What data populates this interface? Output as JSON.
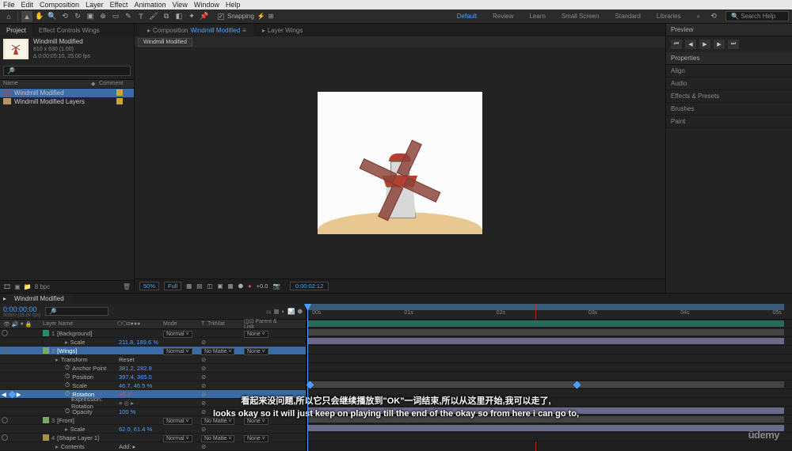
{
  "menu": {
    "items": [
      "File",
      "Edit",
      "Composition",
      "Layer",
      "Effect",
      "Animation",
      "View",
      "Window",
      "Help"
    ]
  },
  "toolbar": {
    "snapping": "Snapping"
  },
  "workspaces": {
    "items": [
      "Default",
      "Review",
      "Learn",
      "Small Screen",
      "Standard",
      "Libraries"
    ],
    "search_placeholder": "Search Help"
  },
  "project_panel": {
    "title": "Project",
    "eff_tab": "Effect Controls Wings",
    "item_name": "Windmill Modified",
    "dims": "810 x 630 (1.00)",
    "dur": "∆ 0:00:05:10, 25.00 fps",
    "col_name": "Name",
    "col_comment": "Comment",
    "rows": [
      {
        "name": "Windmill Modified",
        "type": "comp",
        "sel": true
      },
      {
        "name": "Windmill Modified Layers",
        "type": "folder",
        "sel": false
      }
    ],
    "bpp": "8 bpc"
  },
  "comp_panel": {
    "tab_prefix": "Composition",
    "comp_name": "Windmill Modified",
    "layer_tab": "Layer Wings",
    "sub_tab": "Windmill Modified"
  },
  "viewer_footer": {
    "zoom": "50%",
    "res": "Full",
    "exposure": "+0.0",
    "timecode": "0:00:02:12"
  },
  "right_panel": {
    "preview": "Preview",
    "properties": "Properties",
    "align": "Align",
    "audio": "Audio",
    "effects": "Effects & Presets",
    "brushes": "Brushes",
    "paint": "Paint"
  },
  "timeline": {
    "tab": "Windmill Modified",
    "time": "0:00:00:00",
    "fps_label": "00000 (25.00 fps)",
    "cols": {
      "src": "Layer Name",
      "mode": "Mode",
      "trkmat": "T .TrkMat",
      "parent": "Parent & Link"
    },
    "normal": "Normal",
    "none": "None",
    "nomat": "No Matte",
    "layers": [
      {
        "n": "1",
        "name": "Background",
        "color": "#2a8a6a"
      },
      {
        "n": "",
        "name": "Scale",
        "val": "211.8, 189.6 %",
        "indent": 2,
        "blue": true
      },
      {
        "n": "2",
        "name": "Wings",
        "color": "#7aa860",
        "sel": true
      },
      {
        "n": "",
        "name": "Transform",
        "val": "Reset",
        "indent": 1
      },
      {
        "n": "",
        "name": "Anchor Point",
        "val": "381.2, 282.9",
        "indent": 2,
        "blue": true,
        "sw": true
      },
      {
        "n": "",
        "name": "Position",
        "val": "397.4, 365.0",
        "indent": 2,
        "blue": true,
        "sw": true
      },
      {
        "n": "",
        "name": "Scale",
        "val": "46.7, 46.5 %",
        "indent": 2,
        "blue": true,
        "sw": true
      },
      {
        "n": "",
        "name": "Rotation",
        "val": "+0.0°",
        "indent": 2,
        "red": true,
        "sw": true,
        "sel": true,
        "kf": true
      },
      {
        "n": "",
        "name": "Expression: Rotation",
        "indent": 3,
        "expr": true
      },
      {
        "n": "",
        "name": "Opacity",
        "val": "100 %",
        "indent": 2,
        "blue": true,
        "sw": true
      },
      {
        "n": "3",
        "name": "Front",
        "color": "#7aa860"
      },
      {
        "n": "",
        "name": "Scale",
        "val": "62.0, 61.4 %",
        "indent": 2,
        "blue": true
      },
      {
        "n": "4",
        "name": "Shape Layer 1",
        "color": "#a89048"
      },
      {
        "n": "",
        "name": "Contents",
        "val": "Add: ▸",
        "indent": 1
      }
    ],
    "ruler_marks": [
      "00s",
      "01s",
      "02s",
      "03s",
      "04s",
      "05s"
    ]
  },
  "subtitle": {
    "cn": "看起来没问题,所以它只会继续播放到\"OK\"一词结束,所以从这里开始,我可以走了,",
    "en": "looks okay so it will just keep on playing till the end of the okay so from here i can go to,"
  },
  "branding": {
    "udemy": "demy"
  }
}
